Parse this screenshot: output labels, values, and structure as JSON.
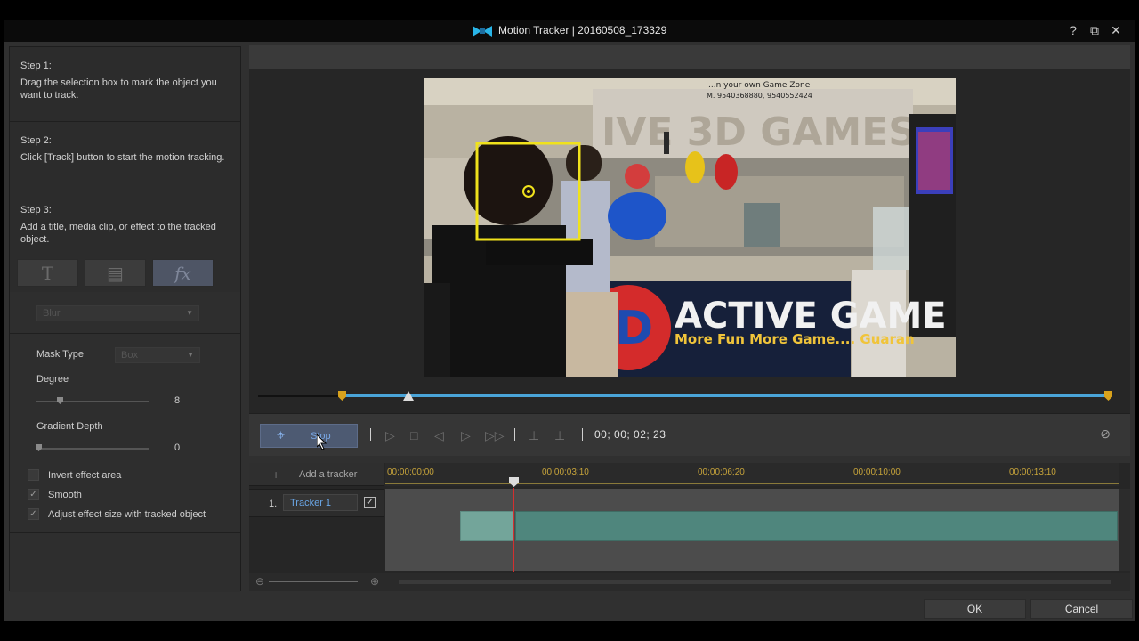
{
  "window": {
    "title": "Motion Tracker | 20160508_173329",
    "help": "?",
    "restore": "⧉",
    "close": "✕"
  },
  "steps": [
    {
      "heading": "Step 1:",
      "text": "Drag the selection box to mark the object you want to track."
    },
    {
      "heading": "Step 2:",
      "text": "Click [Track] button to start the motion tracking."
    },
    {
      "heading": "Step 3:",
      "text": "Add a title, media clip, or effect to the tracked object."
    }
  ],
  "fx_tabs": [
    {
      "glyph": "T",
      "icon": "title-icon"
    },
    {
      "glyph": "▤",
      "icon": "media-clip-icon"
    },
    {
      "glyph": "fx",
      "icon": "effect-icon"
    }
  ],
  "effect": {
    "preset": "Blur",
    "mask_type_label": "Mask Type",
    "mask_type_value": "Box",
    "degree_label": "Degree",
    "degree_value": "8",
    "degree_level": 0.24,
    "gradient_label": "Gradient Depth",
    "gradient_value": "0",
    "gradient_level": 0.0,
    "invert_label": "Invert effect area",
    "invert_checked": false,
    "smooth_label": "Smooth",
    "smooth_checked": true,
    "adjust_label": "Adjust effect size with tracked object",
    "adjust_checked": true
  },
  "controls": {
    "track_label": "Stop",
    "timecode": "00; 00; 02; 23"
  },
  "timeline": {
    "add_tracker_label": "Add a tracker",
    "ruler_labels": [
      "00;00;00;00",
      "00;00;03;10",
      "00;00;06;20",
      "00;00;10;00",
      "00;00;13;10"
    ],
    "tracker_index": "1.",
    "tracker_name": "Tracker 1",
    "tracker_checked": true
  },
  "video": {
    "sign_text_1": "ACTIVE GAME ZO",
    "sign_text_2": "More Fun More Game.... Guaran",
    "banner_text": "IVE 3D GAMES",
    "top_text": "...n your own Game Zone",
    "phone_text": "M. 9540368880, 9540552424"
  },
  "footer": {
    "ok_label": "OK",
    "cancel_label": "Cancel"
  },
  "colors": {
    "accent": "#4aa4d8",
    "selection": "#f0e21c",
    "playhead": "#d23030"
  }
}
